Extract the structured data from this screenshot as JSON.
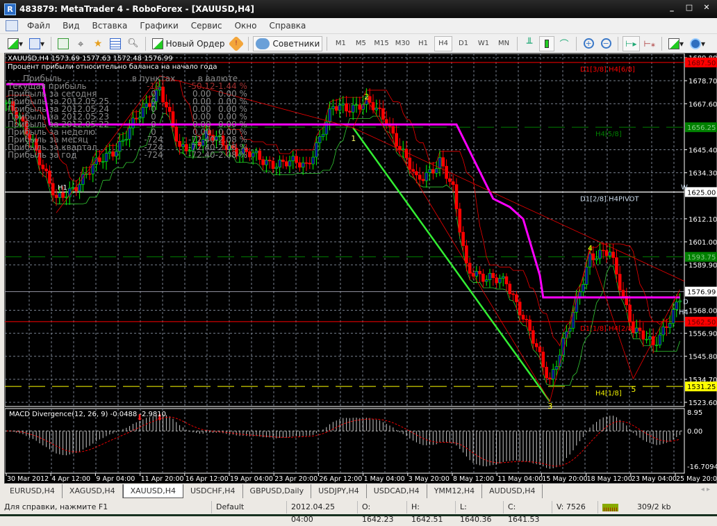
{
  "window": {
    "title": "483879: MetaTrader 4 - RoboForex - [XAUUSD,H4]",
    "min": "_",
    "max": "□",
    "close": "✕"
  },
  "menu": [
    "Файл",
    "Вид",
    "Вставка",
    "Графики",
    "Сервис",
    "Окно",
    "Справка"
  ],
  "toolbar": {
    "new_order": "Новый Ордер",
    "experts": "Советники",
    "timeframes": [
      "M1",
      "M5",
      "M15",
      "M30",
      "H1",
      "H4",
      "D1",
      "W1",
      "MN"
    ],
    "active_timeframe": "H4"
  },
  "chart": {
    "header": "XAUUSD,H4  1573.69 1577.63 1572.48 1576.99",
    "info_title": "Процент прибыли относительно баланса на начало года",
    "info_headers": [
      "Прибыль",
      "в пунктах",
      "в валюте"
    ],
    "info_rows": [
      [
        "Текущая прибыль",
        "-12",
        "-50.12",
        "-1.44 %"
      ],
      [
        "Прибыль за сегодня",
        "0",
        "0.00",
        "0.00 %"
      ],
      [
        "Прибыль за 2012.05.25",
        "0",
        "0.00",
        "0.00 %"
      ],
      [
        "Прибыль за 2012.05.24",
        "0",
        "0.00",
        "0.00 %"
      ],
      [
        "Прибыль за 2012.05.23",
        "0",
        "0.00",
        "0.00 %"
      ],
      [
        "Прибыль за 2012.05.22",
        "0",
        "0.00",
        "0.00 %"
      ],
      [
        "Прибыль за неделю",
        "0",
        "0.00",
        "0.00 %"
      ],
      [
        "Прибыль за месяц",
        "-724",
        "-72.40",
        "-2.08 %"
      ],
      [
        "Прибыль за квартал",
        "-724",
        "-72.40",
        "-2.08 %"
      ],
      [
        "Прибыль за год",
        "-724",
        "-72.40",
        "-2.08 %"
      ]
    ],
    "price_ticks": [
      "1689.80",
      "1678.70",
      "1667.60",
      "1645.40",
      "1634.30",
      "1612.10",
      "1601.00",
      "1589.90",
      "1568.00",
      "1556.90",
      "1545.80",
      "1534.70",
      "1523.60"
    ],
    "price_range": [
      1523.6,
      1689.8
    ],
    "levels": [
      {
        "price": 1687.5,
        "tag": "1687.50",
        "label": "D1[3/8] H4[6/8]",
        "color": "#ff0000",
        "style": "solid"
      },
      {
        "price": 1656.25,
        "tag": "1656.25",
        "label": "H4[5/8]",
        "color": "#008000",
        "style": "dash"
      },
      {
        "price": 1625.0,
        "tag": "1625.00",
        "label": "D1[2/8] H4PIVOT",
        "color": "#ffffff",
        "style": "solid"
      },
      {
        "price": 1593.75,
        "tag": "1593.75",
        "label": "",
        "color": "#008000",
        "style": "dash"
      },
      {
        "price": 1562.5,
        "tag": "1562.50",
        "label": "D1[1/8] H4[2/8]",
        "color": "#ff0000",
        "style": "solid"
      },
      {
        "price": 1531.25,
        "tag": "1531.25",
        "label": "H4[1/8]",
        "color": "#ffff00",
        "style": "dash"
      }
    ],
    "current_price": "1576.99",
    "side_markers": [
      "W",
      "D",
      "H4"
    ],
    "h1_marker": "H1",
    "wave_labels": [
      "1",
      "2",
      "3",
      "4",
      "5"
    ],
    "time_labels": [
      "30 Mar 2012",
      "4 Apr 12:00",
      "9 Apr 04:00",
      "11 Apr 20:00",
      "16 Apr 12:00",
      "19 Apr 04:00",
      "23 Apr 20:00",
      "26 Apr 12:00",
      "1 May 04:00",
      "3 May 20:00",
      "8 May 12:00",
      "11 May 04:00",
      "15 May 20:00",
      "18 May 12:00",
      "23 May 04:00",
      "25 May 20:00"
    ]
  },
  "chart_data": {
    "type": "candlestick",
    "symbol": "XAUUSD",
    "timeframe": "H4",
    "price_waypoints": [
      [
        0,
        1668
      ],
      [
        8,
        1650
      ],
      [
        15,
        1620
      ],
      [
        25,
        1635
      ],
      [
        35,
        1650
      ],
      [
        46,
        1676
      ],
      [
        52,
        1645
      ],
      [
        60,
        1652
      ],
      [
        77,
        1640
      ],
      [
        90,
        1638
      ],
      [
        98,
        1665
      ],
      [
        108,
        1668
      ],
      [
        114,
        1660
      ],
      [
        123,
        1630
      ],
      [
        130,
        1640
      ],
      [
        134,
        1625
      ],
      [
        138,
        1590
      ],
      [
        144,
        1582
      ],
      [
        150,
        1583
      ],
      [
        156,
        1560
      ],
      [
        163,
        1535
      ],
      [
        169,
        1560
      ],
      [
        175,
        1595
      ],
      [
        181,
        1595
      ],
      [
        188,
        1560
      ],
      [
        194,
        1550
      ],
      [
        202,
        1574
      ]
    ],
    "step_line": [
      [
        0,
        1677
      ],
      [
        11,
        1677
      ],
      [
        13,
        1657.6
      ],
      [
        135,
        1657.6
      ],
      [
        146,
        1621.8
      ],
      [
        151,
        1617.8
      ],
      [
        155,
        1612
      ],
      [
        160,
        1584.9
      ],
      [
        161,
        1574.2
      ],
      [
        202,
        1574.2
      ]
    ],
    "macd": {
      "label": "MACD Divergence(12, 26, 9) -0.0488 -2.9810",
      "ticks": [
        "8.95",
        "0.00",
        "-16.7094"
      ],
      "range": [
        -16.7094,
        8.95
      ]
    }
  },
  "tabs": [
    "EURUSD,H4",
    "XAGUSD,H4",
    "XAUUSD,H4",
    "USDCHF,H4",
    "GBPUSD,Daily",
    "USDJPY,H4",
    "USDCAD,H4",
    "YMM12,H4",
    "AUDUSD,H4"
  ],
  "active_tab": "XAUUSD,H4",
  "status": {
    "help": "Для справки, нажмите F1",
    "profile": "Default",
    "time": "2012.04.25 04:00",
    "open": "O: 1642.23",
    "high": "H: 1642.51",
    "low": "L: 1640.36",
    "close": "C: 1641.53",
    "volume": "V: 7526",
    "traffic": "309/2 kb"
  }
}
